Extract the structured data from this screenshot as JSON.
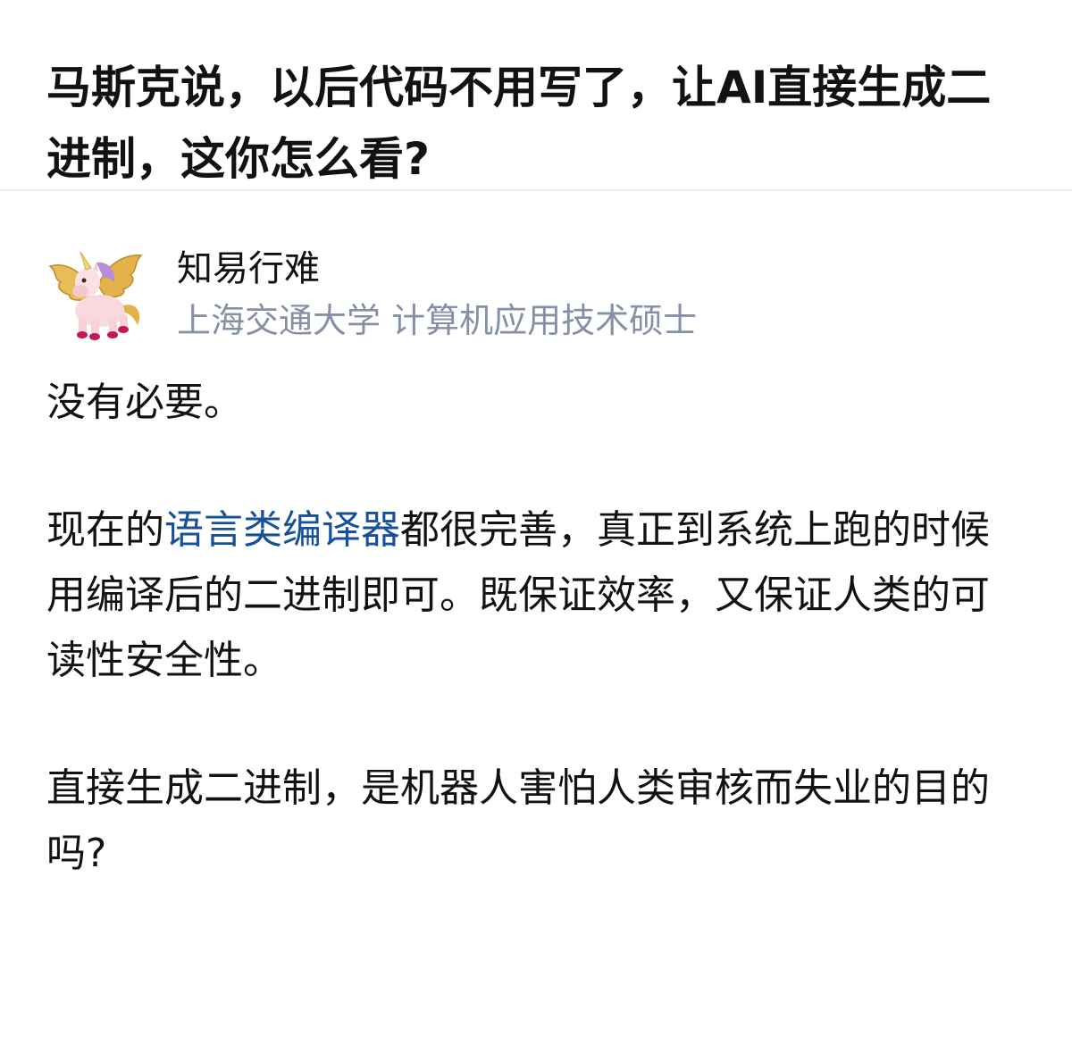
{
  "question": {
    "title": "马斯克说，以后代码不用写了，让AI直接生成二进制，这你怎么看?"
  },
  "author": {
    "avatar_icon": "unicorn-avatar-icon",
    "name": "知易行难",
    "headline": "上海交通大学 计算机应用技术硕士"
  },
  "answer": {
    "para1": "没有必要。",
    "para2_before": "现在的",
    "para2_link": "语言类编译器",
    "para2_after": "都很完善，真正到系统上跑的时候用编译后的二进制即可。既保证效率，又保证人类的可读性安全性。",
    "para3": "直接生成二进制，是机器人害怕人类审核而失业的目的吗?"
  },
  "colors": {
    "text": "#121212",
    "muted": "#8590a6",
    "link": "#175199",
    "divider": "#f0f0f2"
  }
}
